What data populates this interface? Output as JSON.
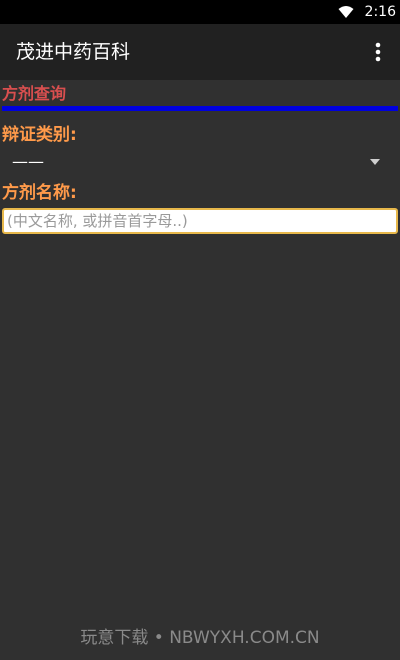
{
  "status_bar": {
    "time": "2:16",
    "icons": [
      "wifi-icon",
      "battery-icon"
    ]
  },
  "toolbar": {
    "title": "茂进中药百科",
    "overflow_icon": "more-vertical-icon"
  },
  "section": {
    "title": "方剂查询",
    "accent_color": "#0000dd"
  },
  "form": {
    "category_label": "辩证类别:",
    "category_value": "——",
    "name_label": "方剂名称:",
    "name_value": "",
    "name_placeholder": "(中文名称, 或拼音首字母..)"
  },
  "watermark": "玩意下载 • NBWYXH.COM.CN",
  "colors": {
    "background": "#303030",
    "toolbar": "#212121",
    "section_title": "#d94f4f",
    "label": "#ff9a4a",
    "input_border": "#e7b84b"
  }
}
